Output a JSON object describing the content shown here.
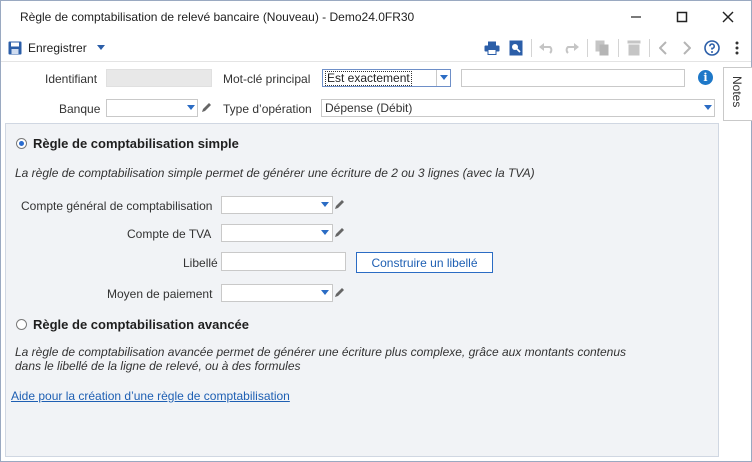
{
  "window": {
    "title": "Règle de comptabilisation de relevé bancaire (Nouveau) - Demo24.0FR30",
    "controls": [
      "minimize-icon",
      "maximize-icon",
      "close-icon"
    ]
  },
  "toolbar": {
    "save_label": "Enregistrer",
    "icons": [
      "save-icon",
      "chevron-down-icon",
      "print-icon",
      "print-preview-icon",
      "undo-icon",
      "redo-icon",
      "copy-icon",
      "delete-icon",
      "previous-icon",
      "next-icon",
      "help-icon",
      "more-icon"
    ]
  },
  "header": {
    "identifiant_label": "Identifiant",
    "identifiant_value": "",
    "keyword_label": "Mot-clé principal",
    "keyword_operator": "Est exactement",
    "keyword_value": "",
    "bank_label": "Banque",
    "bank_value": "",
    "operation_type_label": "Type d’opération",
    "operation_type_value": "Dépense (Débit)"
  },
  "notes_tab": "Notes",
  "simple_rule": {
    "title": "Règle de comptabilisation simple",
    "selected": true,
    "description": "La règle de comptabilisation simple permet de générer une écriture de 2 ou 3 lignes (avec la TVA)",
    "account_label": "Compte général de comptabilisation",
    "account_value": "",
    "vat_label": "Compte de TVA",
    "vat_value": "",
    "libelle_label": "Libellé",
    "libelle_value": "",
    "build_button": "Construire un libellé",
    "payment_label": "Moyen de paiement",
    "payment_value": ""
  },
  "advanced_rule": {
    "title": "Règle de comptabilisation avancée",
    "selected": false,
    "description_line1": "La règle de comptabilisation avancée permet de générer une écriture plus complexe, grâce aux montants contenus",
    "description_line2": "dans le libellé de la ligne de relevé, ou à des formules"
  },
  "help_link": "Aide pour la création d’une règle de comptabilisation",
  "colors": {
    "accent": "#2b6cc4",
    "link": "#1e5fb3",
    "panel_bg": "#f1f3f6",
    "info": "#1e78c8"
  }
}
